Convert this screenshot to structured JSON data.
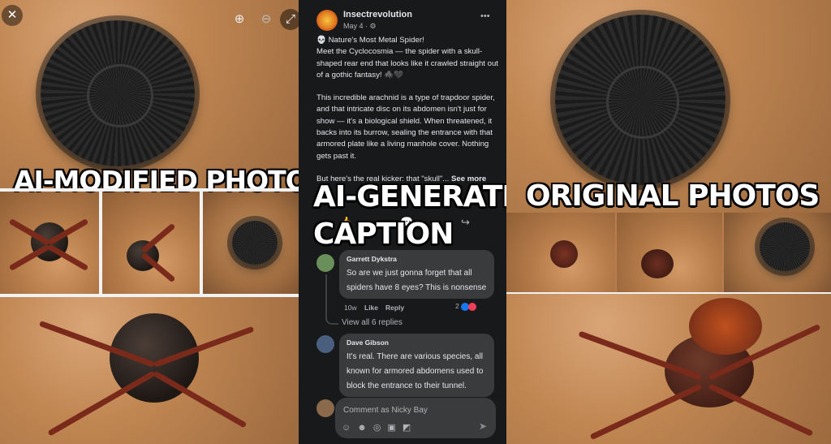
{
  "left_panel": {
    "caption": "AI-MODIFIED PHOTO",
    "overlay_icons": [
      "close-icon",
      "zoom-in-icon",
      "zoom-out-icon",
      "expand-icon"
    ]
  },
  "middle_panel": {
    "caption_line1": "AI-GENERATED",
    "caption_line2": "CAPTION",
    "page_name": "Insectrevolution",
    "post_date": "May 4 ·",
    "privacy_icon": "gear-icon",
    "more_icon": "•••",
    "post_p1": "💀 Nature's Most Metal Spider!\nMeet the Cyclocosmia — the spider with a skull-shaped rear end that looks like it crawled straight out of a gothic fantasy! 🕷️🖤",
    "post_p2": "This incredible arachnid is a type of trapdoor spider, and that intricate disc on its abdomen isn't just for show — it's a biological shield. When threatened, it backs into its burrow, sealing the entrance with that armored plate like a living manhole cover. Nothing gets past it.",
    "post_p3_prefix": "But here's the real kicker: that \"skull\"...",
    "see_more": "See more",
    "comments": [
      {
        "name": "Garrett Dykstra",
        "text": "So are we just gonna forget that all spiders have 8 eyes? This is nonsense",
        "time": "10w",
        "like": "Like",
        "reply": "Reply",
        "reactions": "2"
      },
      {
        "name": "Dave Gibson",
        "text": "It's real. There are various species, all known for armored abdomens used to block the entrance to their tunnel."
      }
    ],
    "view_replies": "View all 6 replies",
    "comment_placeholder": "Comment as Nicky Bay"
  },
  "right_panel": {
    "caption": "ORIGINAL PHOTOS"
  },
  "colors": {
    "facebook_dark_bg": "#18191a",
    "comment_bubble": "#3a3b3c",
    "soil": "#c48a5a",
    "like_blue": "#1877f2",
    "love_red": "#f33e58"
  }
}
